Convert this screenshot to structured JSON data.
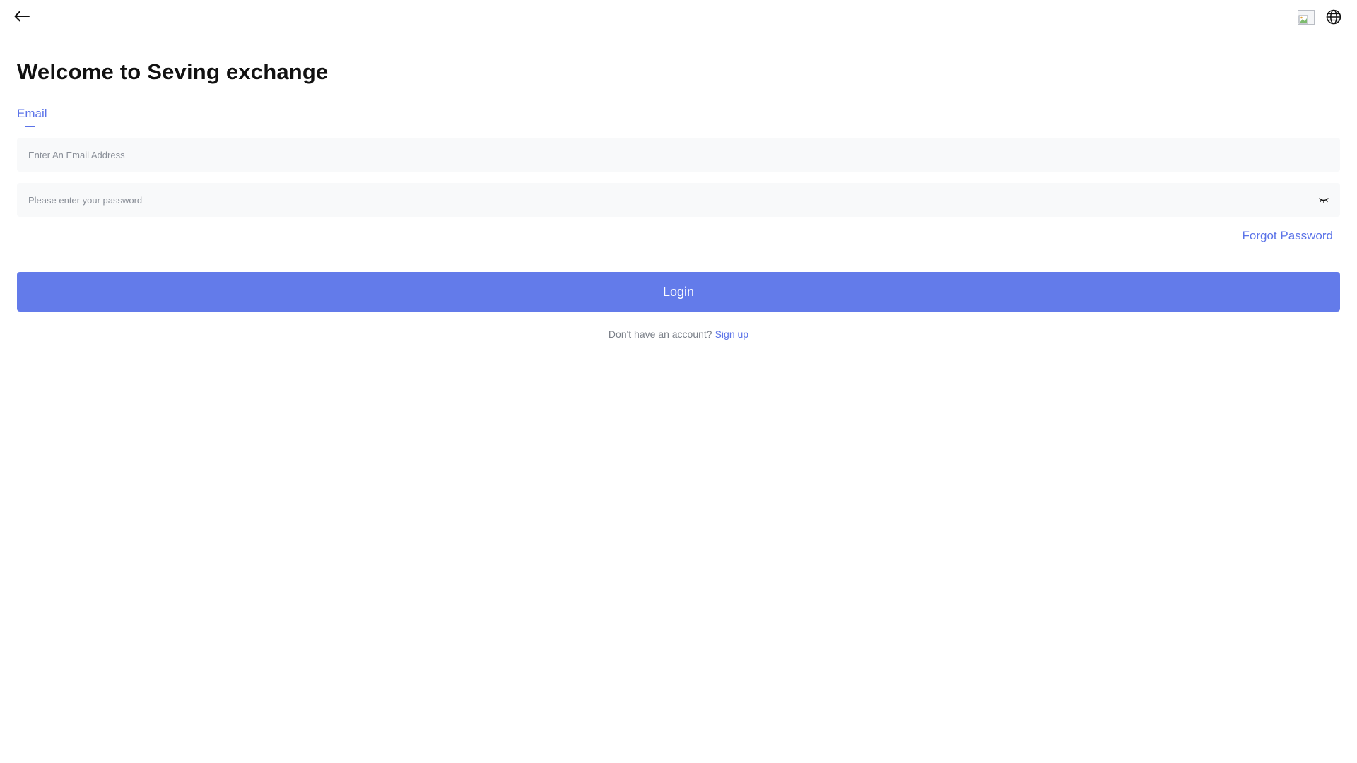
{
  "header": {
    "back_icon": "arrow-left-icon",
    "flag_icon": "broken-image-icon",
    "globe_icon": "globe-icon"
  },
  "page": {
    "title": "Welcome to Seving exchange"
  },
  "tabs": [
    {
      "label": "Email",
      "active": true
    }
  ],
  "form": {
    "email_placeholder": "Enter An Email Address",
    "email_value": "",
    "password_placeholder": "Please enter your password",
    "password_value": "",
    "eye_icon": "eye-closed-icon",
    "forgot_label": "Forgot Password",
    "login_label": "Login"
  },
  "footer": {
    "prompt": "Don't have an account?",
    "signup_label": "Sign up"
  },
  "colors": {
    "accent": "#5b73e8",
    "button": "#637bea",
    "input_bg": "#f8f9fa"
  }
}
